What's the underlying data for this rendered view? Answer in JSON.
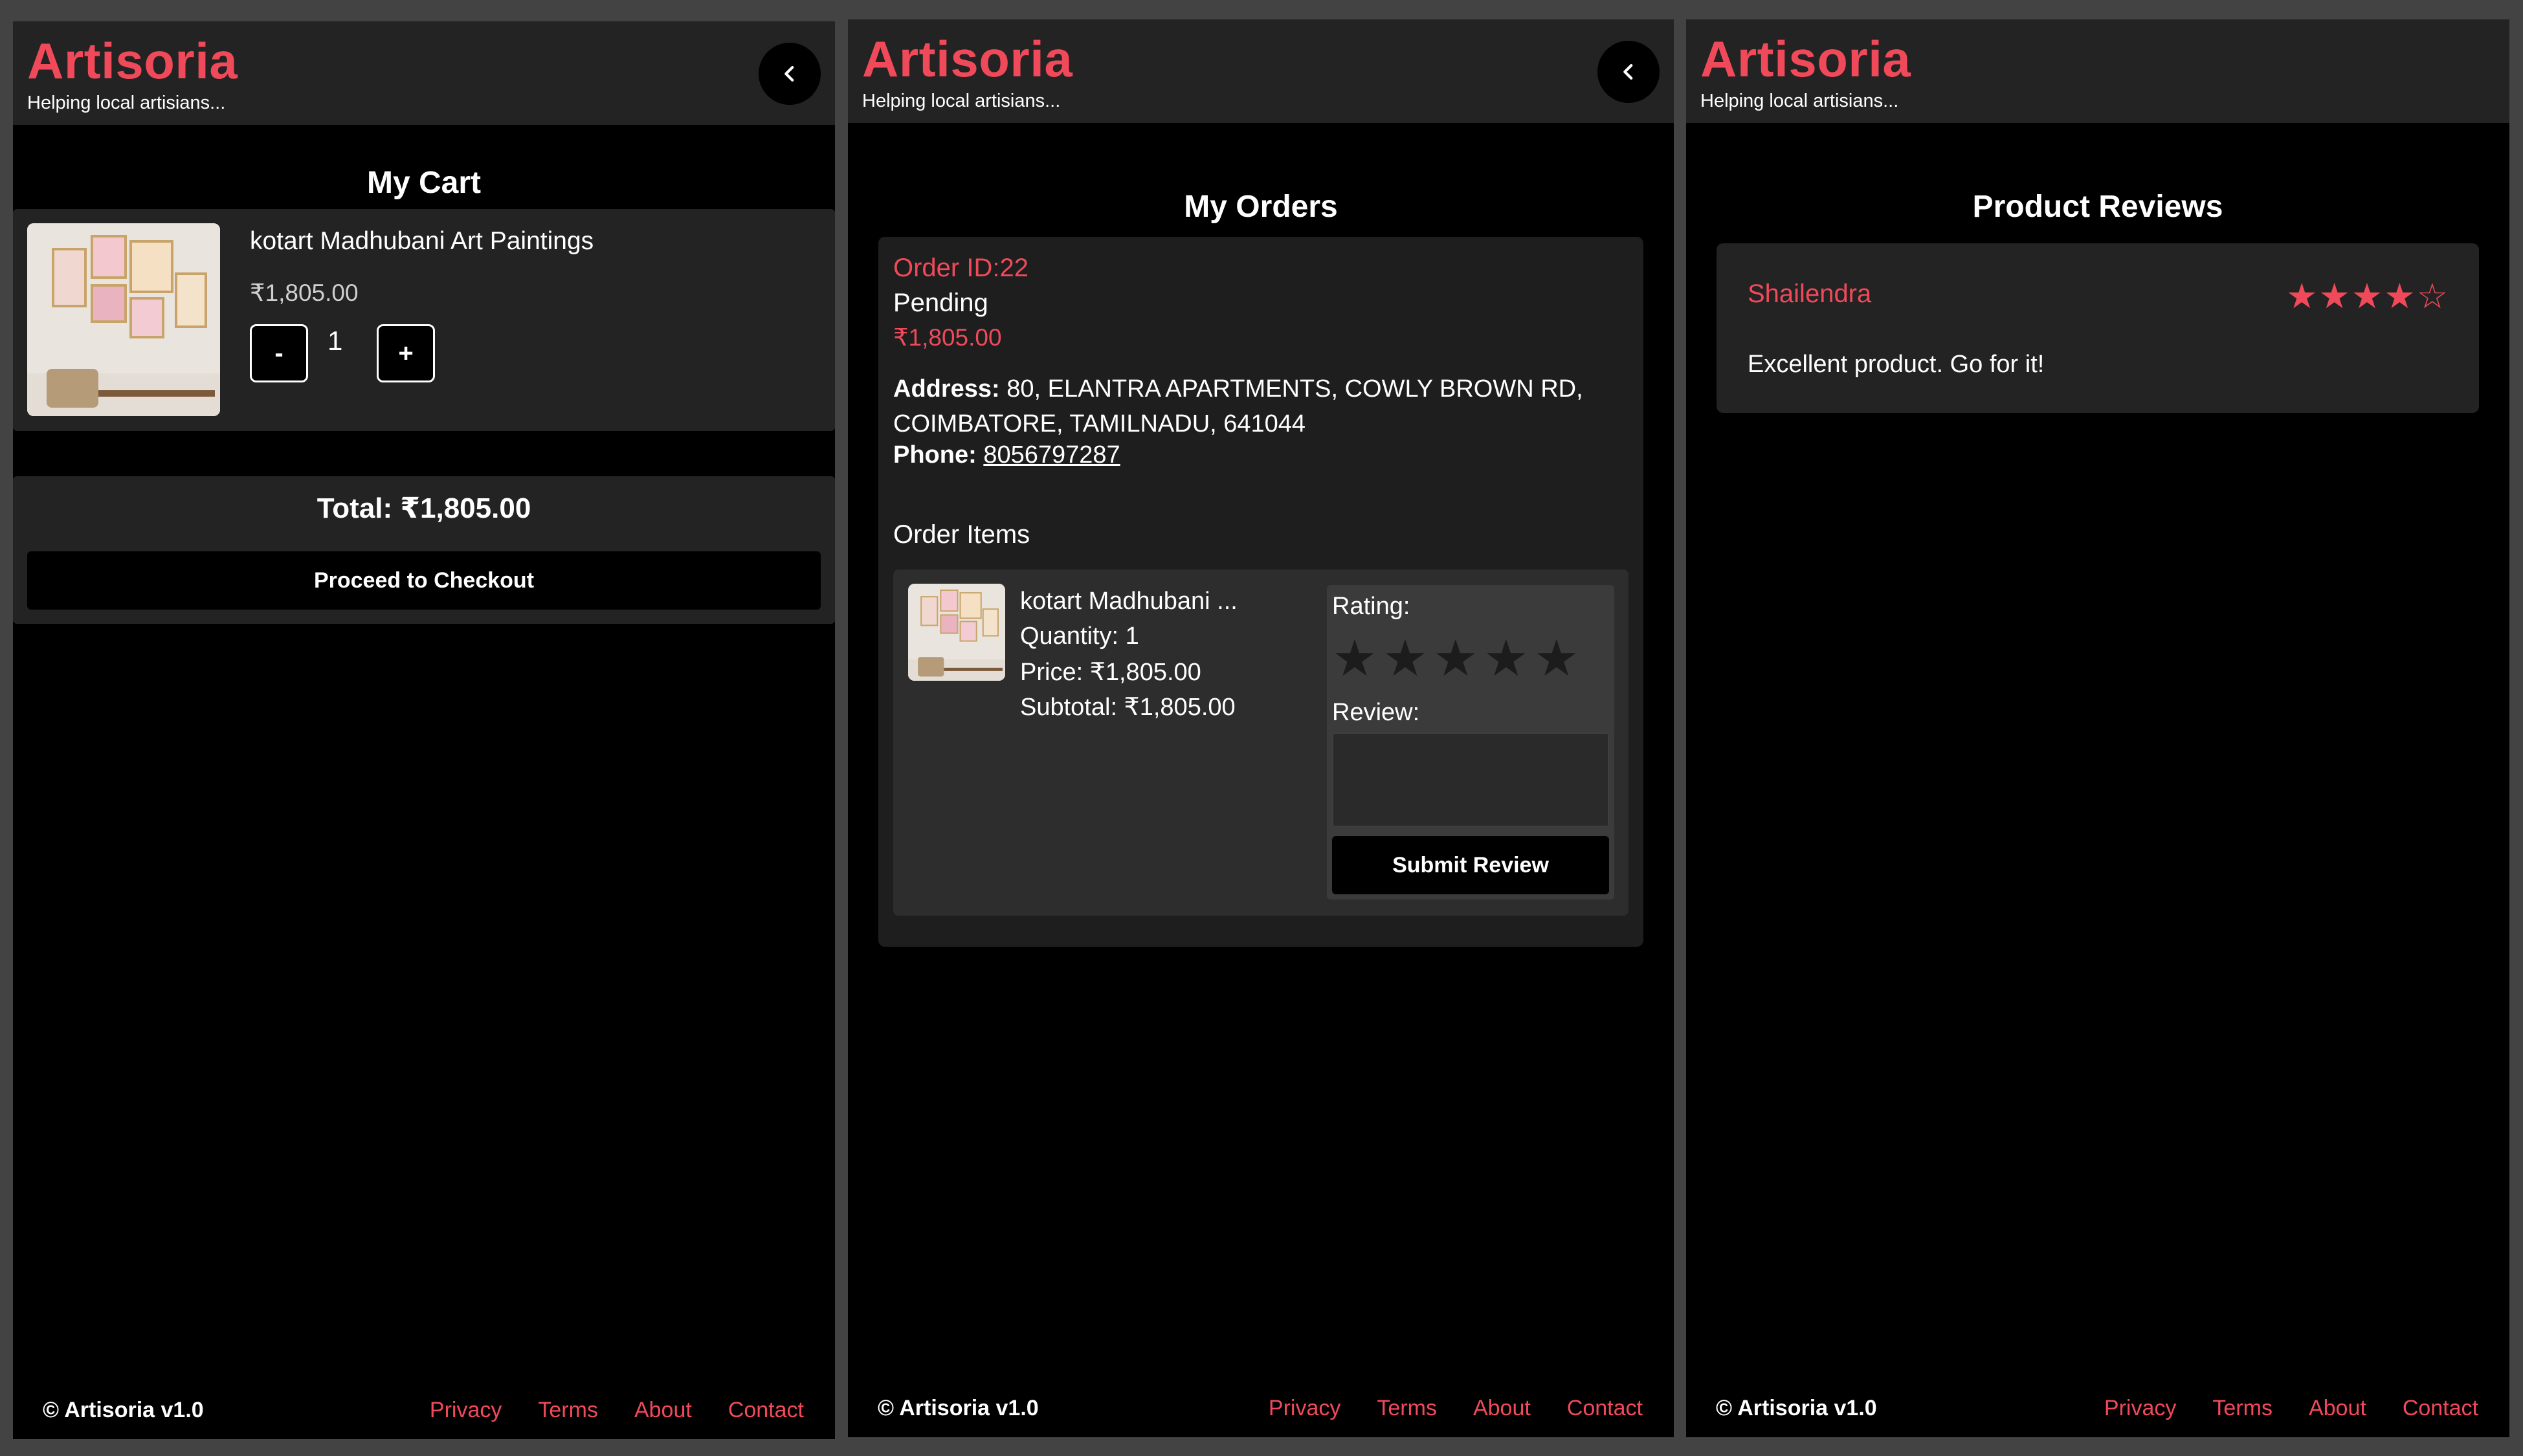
{
  "app": {
    "brand": "Artisoria",
    "tagline": "Helping local artisians...",
    "accent_color": "#f04a5a"
  },
  "footer": {
    "copyright": "© Artisoria v1.0",
    "links": [
      "Privacy",
      "Terms",
      "About",
      "Contact"
    ]
  },
  "cart": {
    "title": "My Cart",
    "item": {
      "name": "kotart Madhubani Art Paintings",
      "price": "₹1,805.00",
      "quantity": "1",
      "decrement_label": "-",
      "increment_label": "+"
    },
    "total": "Total: ₹1,805.00",
    "checkout_label": "Proceed to Checkout"
  },
  "orders": {
    "title": "My Orders",
    "order_id": "Order ID:22",
    "status": "Pending",
    "amount": "₹1,805.00",
    "address_label": "Address:",
    "address": "80, ELANTRA APARTMENTS, COWLY BROWN RD, COIMBATORE, TAMILNADU, 641044",
    "phone_label": "Phone:",
    "phone": "8056797287",
    "items_heading": "Order Items",
    "item": {
      "name": "kotart Madhubani ...",
      "quantity": "Quantity: 1",
      "price": "Price: ₹1,805.00",
      "subtotal": "Subtotal: ₹1,805.00"
    },
    "rating_label": "Rating:",
    "rating_value": 0,
    "rating_max": 5,
    "review_label": "Review:",
    "review_value": "",
    "submit_label": "Submit Review"
  },
  "reviews": {
    "title": "Product Reviews",
    "list": [
      {
        "reviewer": "Shailendra",
        "stars": "★★★★☆",
        "rating": 4,
        "text": "Excellent product. Go for  it!"
      }
    ]
  }
}
